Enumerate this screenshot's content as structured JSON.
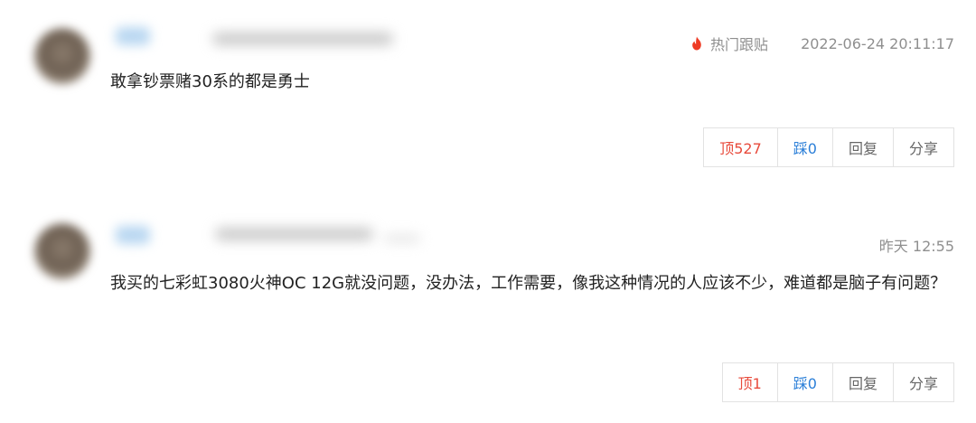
{
  "comments": [
    {
      "hot_label": "热门跟贴",
      "timestamp": "2022-06-24 20:11:17",
      "text": "敢拿钞票赌30系的都是勇士",
      "up_label": "顶527",
      "down_label": "踩0",
      "reply_label": "回复",
      "share_label": "分享"
    },
    {
      "timestamp": "昨天 12:55",
      "text": "我买的七彩虹3080火神OC 12G就没问题，没办法，工作需要，像我这种情况的人应该不少，难道都是脑子有问题？",
      "up_label": "顶1",
      "down_label": "踩0",
      "reply_label": "回复",
      "share_label": "分享"
    }
  ],
  "colors": {
    "up": "#e84b3c",
    "down": "#2b7fd8",
    "hot_icon": "#ee3b24",
    "meta": "#8f8f8f"
  },
  "icons": {
    "hot": "flame-icon"
  }
}
